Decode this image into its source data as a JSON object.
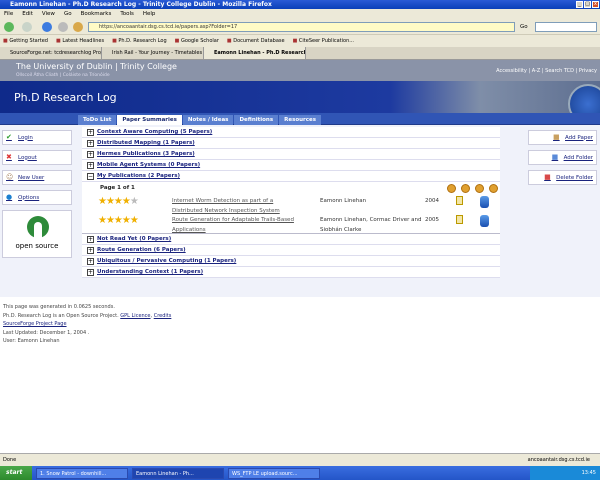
{
  "browser": {
    "window_title": "Eamonn Linehan - Ph.D Research Log - Trinity College Dublin - Mozilla Firefox",
    "menu": [
      "File",
      "Edit",
      "View",
      "Go",
      "Bookmarks",
      "Tools",
      "Help"
    ],
    "url": "https://ancoaantair.dsg.cs.tcd.ie/papers.asp?Folder=17",
    "go_label": "Go",
    "bookmarks": [
      "Getting Started",
      "Latest Headlines",
      "Ph.D. Research Log",
      "Google Scholar",
      "Document Database",
      "CiteSeer Publication..."
    ],
    "tabs": [
      "SourceForge.net: tcdresearchlog Project: ...",
      "Irish Rail - Your Journey - Timetables",
      "Eamonn Linehan - Ph.D Research Lo..."
    ],
    "status": "Done",
    "status_url": "ancoaantair.dsg.cs.tcd.ie"
  },
  "site": {
    "university": "The University of Dublin | Trinity College",
    "university_irish": "Ollscoil Átha Cliath | Coláiste na Tríonóide",
    "top_links": "Accessibility | A-Z | Search TCD | Privacy",
    "title": "Ph.D Research Log",
    "tabs": [
      "ToDo List",
      "Paper Summaries",
      "Notes / Ideas",
      "Definitions",
      "Resources"
    ]
  },
  "left_sidebar": [
    "Login",
    "Logout",
    "New User",
    "Options"
  ],
  "open_source_label": "open source",
  "right_sidebar": [
    "Add Paper",
    "Add Folder",
    "Delete Folder"
  ],
  "folders_before": [
    "Context Aware Computing (5 Papers)",
    "Distributed Mapping (1 Papers)",
    "Hermes Publications (3 Papers)",
    "Mobile Agent Systems (0 Papers)",
    "My Publications (2 Papers)"
  ],
  "page_info": "Page 1 of 1",
  "papers": [
    {
      "rating": 4,
      "title": "Internet Worm Detection as part of a Distributed Network Inspection System",
      "authors": "Eamonn Linehan",
      "year": "2004"
    },
    {
      "rating": 5,
      "title": "Route Generation for Adaptable Trails-Based Applications",
      "authors": "Eamonn Linehan, Cormac Driver and Siobhán Clarke",
      "year": "2005"
    }
  ],
  "folders_after": [
    "Not Read Yet (0 Papers)",
    "Route Generation (6 Papers)",
    "Ubiquitous / Pervasive Computing (1 Papers)",
    "Understanding Context (1 Papers)"
  ],
  "footer": {
    "generated": "This page was generated in 0.0625 seconds.",
    "oss": "Ph.D. Research Log is an Open Source Project.",
    "gpl": "GPL Licence",
    "credits": "Credits",
    "sf": "SourceForge Project Page",
    "updated": "Last Updated: December 1, 2004 .",
    "user": "User: Eamonn Linehan"
  },
  "taskbar": {
    "start": "start",
    "tasks": [
      "1. Snow Patrol - downhill...",
      "Eamonn Linehan - Ph...",
      "WS_FTP LE upload.sourc..."
    ],
    "time": "13:45"
  }
}
